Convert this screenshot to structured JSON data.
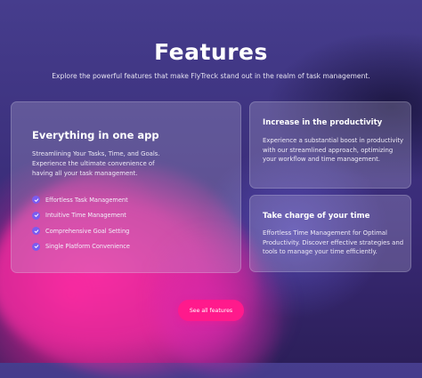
{
  "header": {
    "title": "Features",
    "subtitle": "Explore the powerful features that make FlyTreck stand out in the realm of task management."
  },
  "main_card": {
    "title": "Everything in one app",
    "description": "Streamlining Your Tasks, Time, and Goals. Experience the ultimate convenience of having all your task management.",
    "features": [
      {
        "label": "Effortless Task Management",
        "icon": "check-circle-icon"
      },
      {
        "label": "Intuitive Time Management",
        "icon": "check-circle-icon"
      },
      {
        "label": "Comprehensive Goal Setting",
        "icon": "check-circle-icon"
      },
      {
        "label": "Single Platform Convenience",
        "icon": "check-circle-icon"
      }
    ]
  },
  "productivity_card": {
    "title": "Increase in the productivity",
    "description": "Experience a substantial boost in productivity with our streamlined approach, optimizing your workflow and time management."
  },
  "time_card": {
    "title": "Take charge of your time",
    "description": "Effortless Time Management for Optimal Productivity. Discover effective strategies and tools to manage your time efficiently."
  },
  "cta": {
    "label": "See all features"
  },
  "colors": {
    "accent": "#ff1a8c",
    "check": "#7a5cf0",
    "background": "#3e3380"
  }
}
